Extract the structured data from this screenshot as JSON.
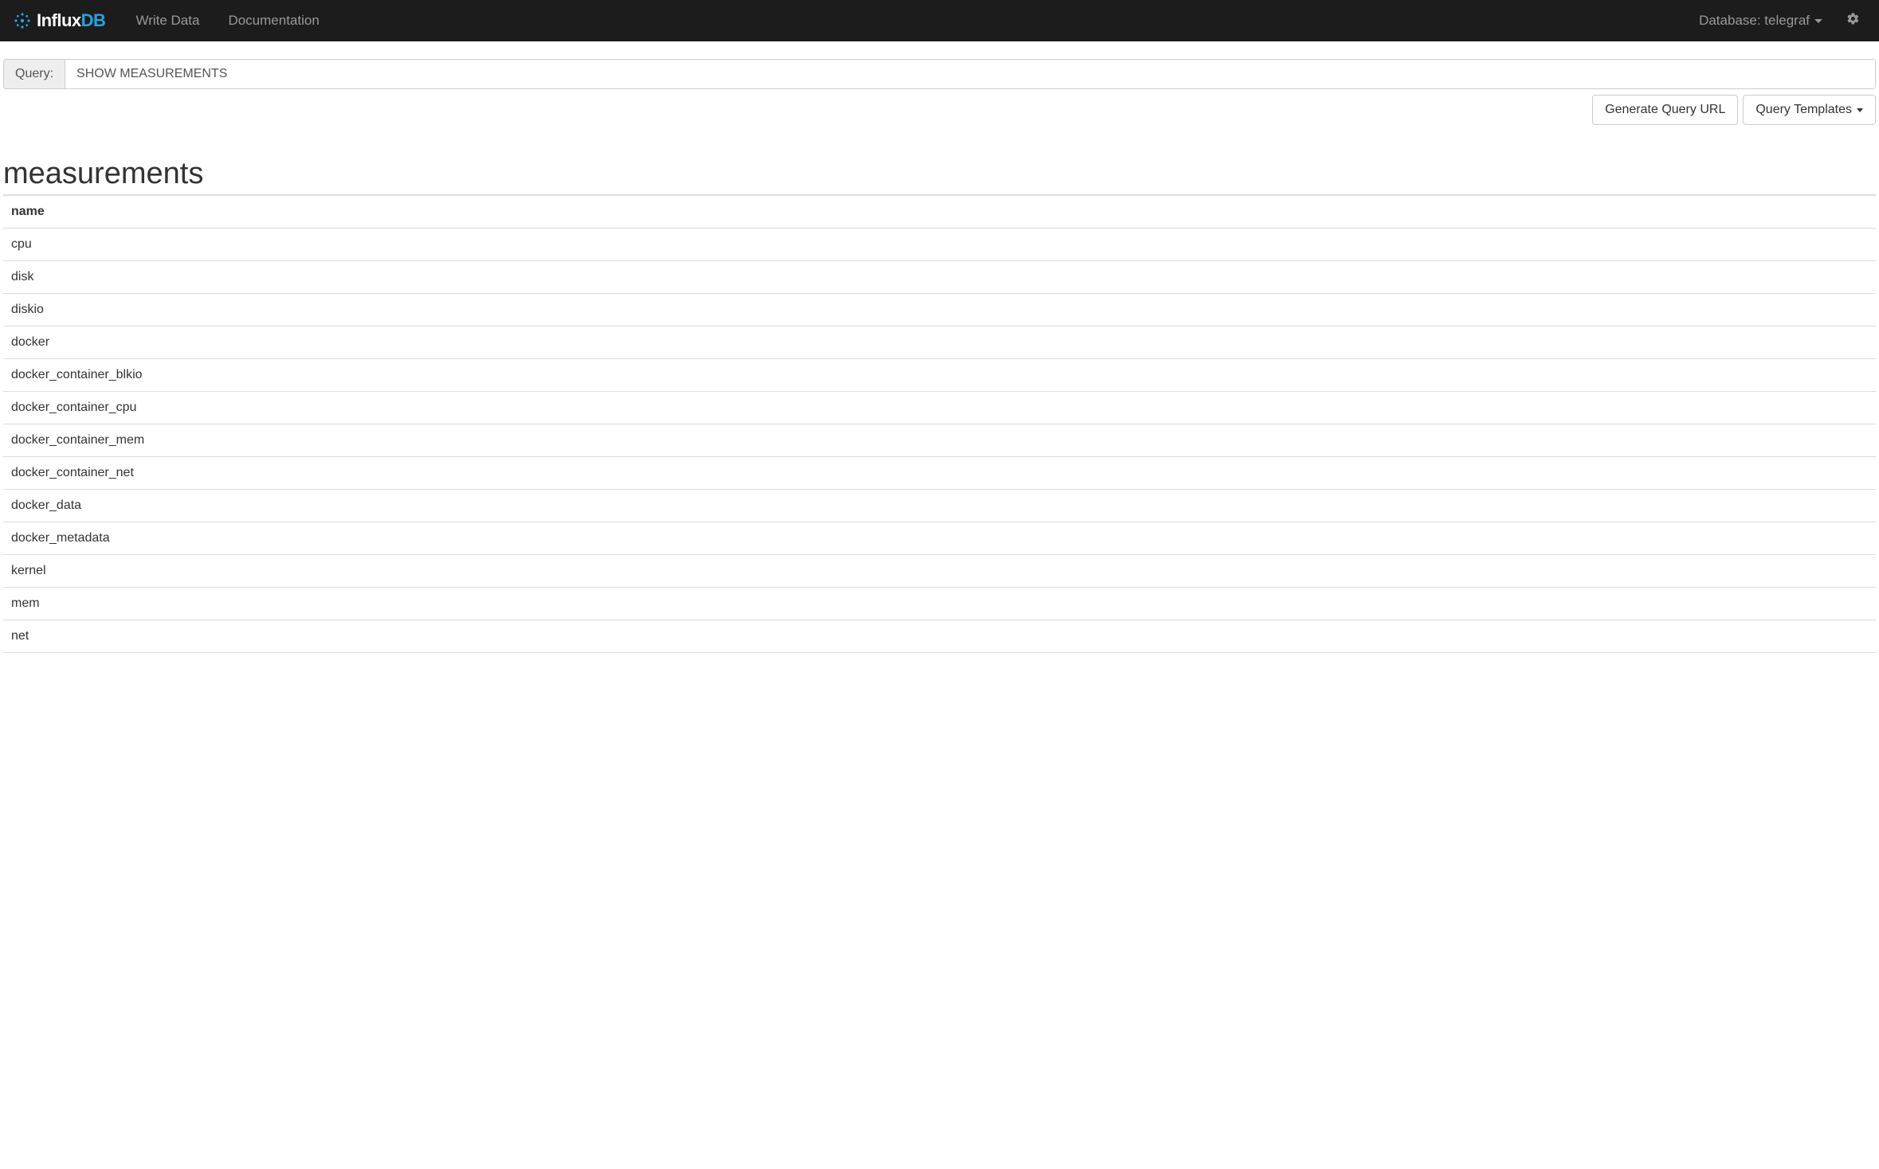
{
  "navbar": {
    "brand_influx": "Influx",
    "brand_db": "DB",
    "links": {
      "write_data": "Write Data",
      "documentation": "Documentation"
    },
    "database_label": "Database: telegraf"
  },
  "query": {
    "label": "Query:",
    "value": "SHOW MEASUREMENTS"
  },
  "buttons": {
    "generate_url": "Generate Query URL",
    "templates": "Query Templates"
  },
  "results": {
    "title": "measurements",
    "column": "name",
    "rows": [
      "cpu",
      "disk",
      "diskio",
      "docker",
      "docker_container_blkio",
      "docker_container_cpu",
      "docker_container_mem",
      "docker_container_net",
      "docker_data",
      "docker_metadata",
      "kernel",
      "mem",
      "net"
    ]
  }
}
